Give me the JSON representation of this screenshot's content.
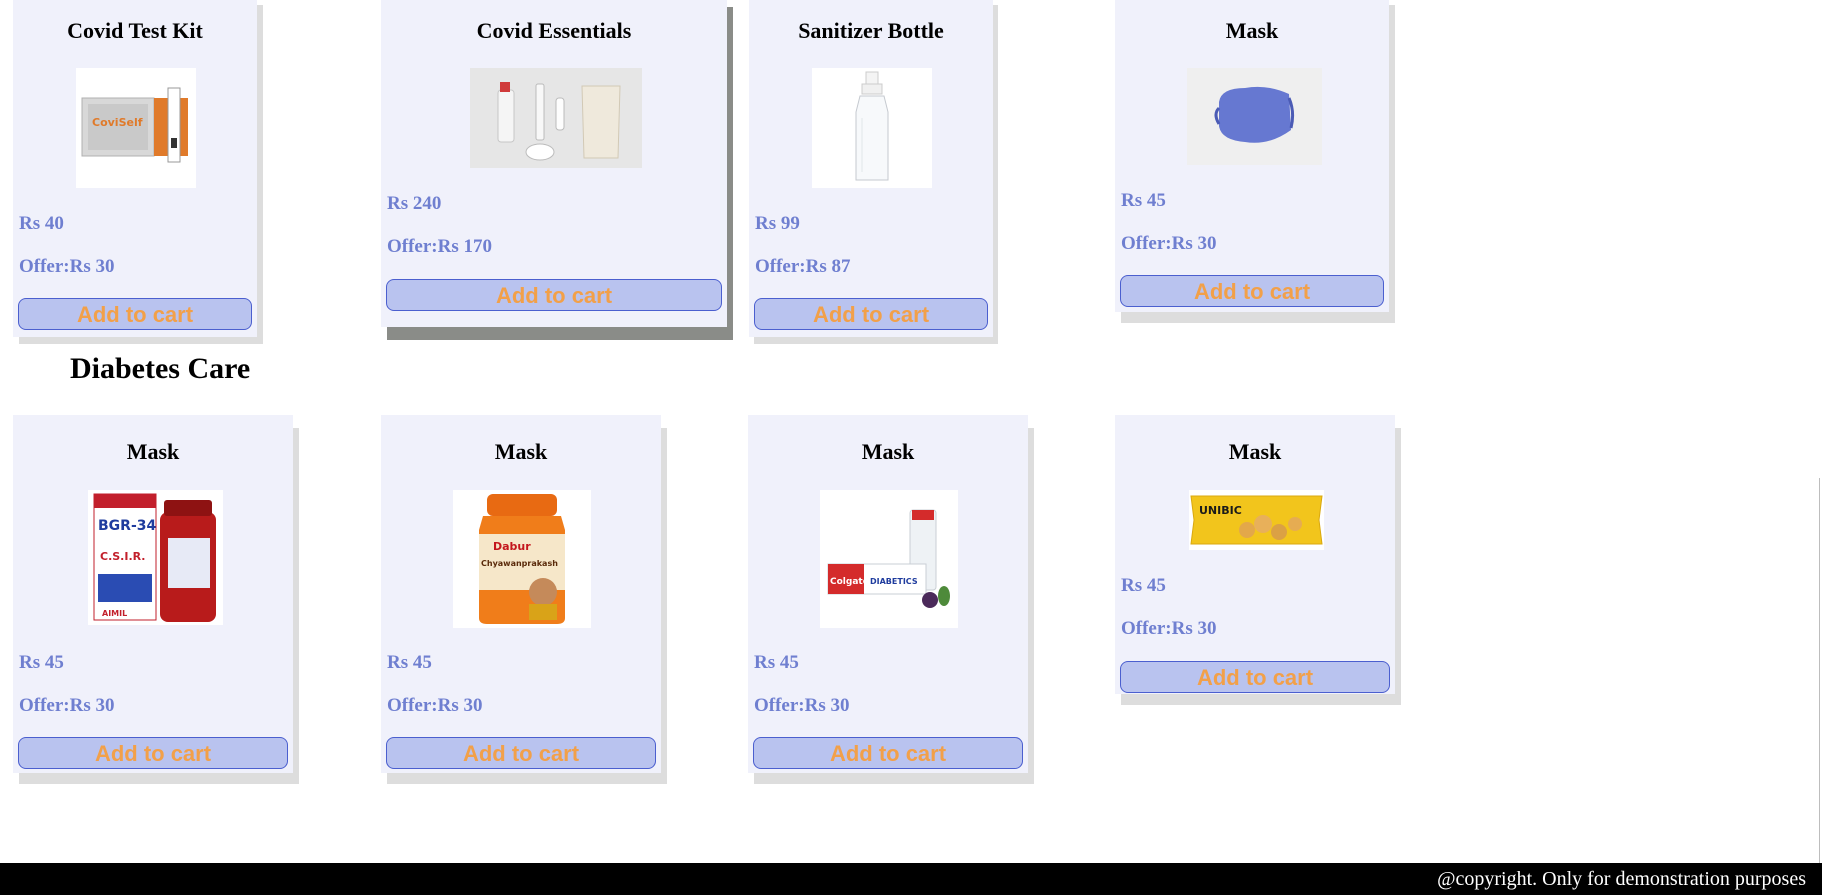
{
  "covid_products": [
    {
      "name": "Covid Test Kit",
      "price": "Rs 40",
      "offer": "Offer:Rs 30",
      "cart": "Add to cart"
    },
    {
      "name": "Covid Essentials",
      "price": "Rs 240",
      "offer": "Offer:Rs 170",
      "cart": "Add to cart"
    },
    {
      "name": "Sanitizer Bottle",
      "price": "Rs 99",
      "offer": "Offer:Rs 87",
      "cart": "Add to cart"
    },
    {
      "name": "Mask",
      "price": "Rs 45",
      "offer": "Offer:Rs 30",
      "cart": "Add to cart"
    }
  ],
  "diabetes_section": {
    "title": "Diabetes Care"
  },
  "diabetes_products": [
    {
      "name": "Mask",
      "price": "Rs 45",
      "offer": "Offer:Rs 30",
      "cart": "Add to cart"
    },
    {
      "name": "Mask",
      "price": "Rs 45",
      "offer": "Offer:Rs 30",
      "cart": "Add to cart"
    },
    {
      "name": "Mask",
      "price": "Rs 45",
      "offer": "Offer:Rs 30",
      "cart": "Add to cart"
    },
    {
      "name": "Mask",
      "price": "Rs 45",
      "offer": "Offer:Rs 30",
      "cart": "Add to cart"
    }
  ],
  "footer": {
    "text": "@copyright. Only for demonstration purposes"
  },
  "image_text": {
    "test_kit_brand": "CoviSelf",
    "bgr_name": "BGR-34",
    "bgr_org": "C.S.I.R.",
    "bgr_maker": "AIMIL",
    "chyawan_brand": "Dabur",
    "chyawan_name": "Chyawanprakash",
    "colgate_brand": "Colgate",
    "colgate_variant": "DIABETICS",
    "unibic_brand": "UNIBIC"
  },
  "colors": {
    "card_bg": "#f0f1fb",
    "price_text": "#6f7fd0",
    "button_bg": "#b9c3ef",
    "button_text": "#f2a049",
    "footer_bg": "#000000"
  }
}
